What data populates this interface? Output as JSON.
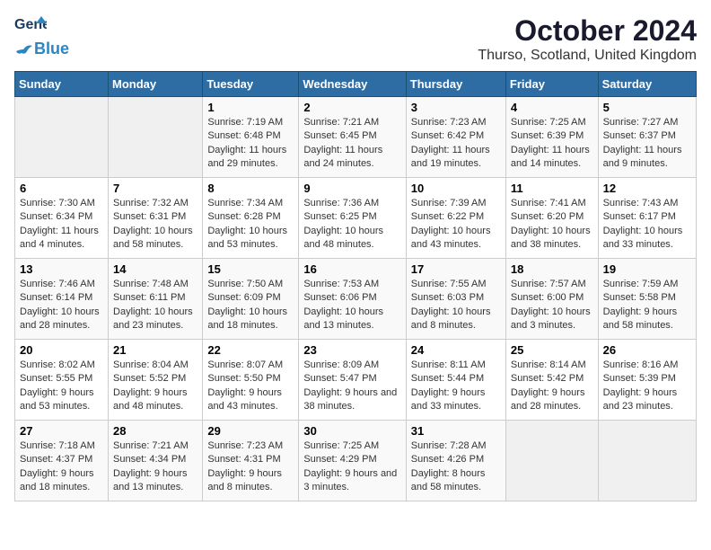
{
  "header": {
    "logo_general": "General",
    "logo_blue": "Blue",
    "month": "October 2024",
    "location": "Thurso, Scotland, United Kingdom"
  },
  "days_of_week": [
    "Sunday",
    "Monday",
    "Tuesday",
    "Wednesday",
    "Thursday",
    "Friday",
    "Saturday"
  ],
  "weeks": [
    [
      {
        "day": "",
        "info": ""
      },
      {
        "day": "",
        "info": ""
      },
      {
        "day": "1",
        "info": "Sunrise: 7:19 AM\nSunset: 6:48 PM\nDaylight: 11 hours and 29 minutes."
      },
      {
        "day": "2",
        "info": "Sunrise: 7:21 AM\nSunset: 6:45 PM\nDaylight: 11 hours and 24 minutes."
      },
      {
        "day": "3",
        "info": "Sunrise: 7:23 AM\nSunset: 6:42 PM\nDaylight: 11 hours and 19 minutes."
      },
      {
        "day": "4",
        "info": "Sunrise: 7:25 AM\nSunset: 6:39 PM\nDaylight: 11 hours and 14 minutes."
      },
      {
        "day": "5",
        "info": "Sunrise: 7:27 AM\nSunset: 6:37 PM\nDaylight: 11 hours and 9 minutes."
      }
    ],
    [
      {
        "day": "6",
        "info": "Sunrise: 7:30 AM\nSunset: 6:34 PM\nDaylight: 11 hours and 4 minutes."
      },
      {
        "day": "7",
        "info": "Sunrise: 7:32 AM\nSunset: 6:31 PM\nDaylight: 10 hours and 58 minutes."
      },
      {
        "day": "8",
        "info": "Sunrise: 7:34 AM\nSunset: 6:28 PM\nDaylight: 10 hours and 53 minutes."
      },
      {
        "day": "9",
        "info": "Sunrise: 7:36 AM\nSunset: 6:25 PM\nDaylight: 10 hours and 48 minutes."
      },
      {
        "day": "10",
        "info": "Sunrise: 7:39 AM\nSunset: 6:22 PM\nDaylight: 10 hours and 43 minutes."
      },
      {
        "day": "11",
        "info": "Sunrise: 7:41 AM\nSunset: 6:20 PM\nDaylight: 10 hours and 38 minutes."
      },
      {
        "day": "12",
        "info": "Sunrise: 7:43 AM\nSunset: 6:17 PM\nDaylight: 10 hours and 33 minutes."
      }
    ],
    [
      {
        "day": "13",
        "info": "Sunrise: 7:46 AM\nSunset: 6:14 PM\nDaylight: 10 hours and 28 minutes."
      },
      {
        "day": "14",
        "info": "Sunrise: 7:48 AM\nSunset: 6:11 PM\nDaylight: 10 hours and 23 minutes."
      },
      {
        "day": "15",
        "info": "Sunrise: 7:50 AM\nSunset: 6:09 PM\nDaylight: 10 hours and 18 minutes."
      },
      {
        "day": "16",
        "info": "Sunrise: 7:53 AM\nSunset: 6:06 PM\nDaylight: 10 hours and 13 minutes."
      },
      {
        "day": "17",
        "info": "Sunrise: 7:55 AM\nSunset: 6:03 PM\nDaylight: 10 hours and 8 minutes."
      },
      {
        "day": "18",
        "info": "Sunrise: 7:57 AM\nSunset: 6:00 PM\nDaylight: 10 hours and 3 minutes."
      },
      {
        "day": "19",
        "info": "Sunrise: 7:59 AM\nSunset: 5:58 PM\nDaylight: 9 hours and 58 minutes."
      }
    ],
    [
      {
        "day": "20",
        "info": "Sunrise: 8:02 AM\nSunset: 5:55 PM\nDaylight: 9 hours and 53 minutes."
      },
      {
        "day": "21",
        "info": "Sunrise: 8:04 AM\nSunset: 5:52 PM\nDaylight: 9 hours and 48 minutes."
      },
      {
        "day": "22",
        "info": "Sunrise: 8:07 AM\nSunset: 5:50 PM\nDaylight: 9 hours and 43 minutes."
      },
      {
        "day": "23",
        "info": "Sunrise: 8:09 AM\nSunset: 5:47 PM\nDaylight: 9 hours and 38 minutes."
      },
      {
        "day": "24",
        "info": "Sunrise: 8:11 AM\nSunset: 5:44 PM\nDaylight: 9 hours and 33 minutes."
      },
      {
        "day": "25",
        "info": "Sunrise: 8:14 AM\nSunset: 5:42 PM\nDaylight: 9 hours and 28 minutes."
      },
      {
        "day": "26",
        "info": "Sunrise: 8:16 AM\nSunset: 5:39 PM\nDaylight: 9 hours and 23 minutes."
      }
    ],
    [
      {
        "day": "27",
        "info": "Sunrise: 7:18 AM\nSunset: 4:37 PM\nDaylight: 9 hours and 18 minutes."
      },
      {
        "day": "28",
        "info": "Sunrise: 7:21 AM\nSunset: 4:34 PM\nDaylight: 9 hours and 13 minutes."
      },
      {
        "day": "29",
        "info": "Sunrise: 7:23 AM\nSunset: 4:31 PM\nDaylight: 9 hours and 8 minutes."
      },
      {
        "day": "30",
        "info": "Sunrise: 7:25 AM\nSunset: 4:29 PM\nDaylight: 9 hours and 3 minutes."
      },
      {
        "day": "31",
        "info": "Sunrise: 7:28 AM\nSunset: 4:26 PM\nDaylight: 8 hours and 58 minutes."
      },
      {
        "day": "",
        "info": ""
      },
      {
        "day": "",
        "info": ""
      }
    ]
  ]
}
